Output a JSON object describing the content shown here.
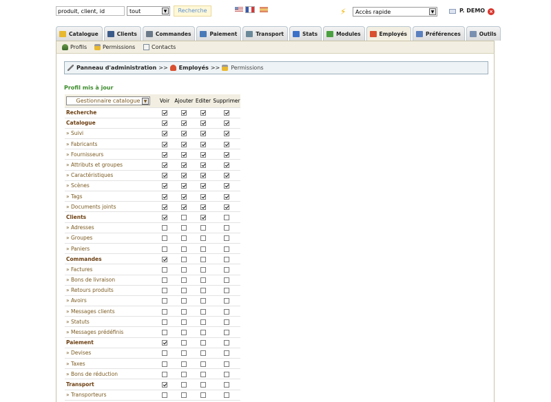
{
  "topbar": {
    "search_value": "produit, client, id",
    "search_type": "tout",
    "search_button": "Recherche",
    "quick_access": "Accès rapide",
    "user_name": "P. DEMO"
  },
  "tabs": [
    {
      "label": "Catalogue",
      "icon": "folder-icon",
      "color": "#e8b830"
    },
    {
      "label": "Clients",
      "icon": "person-icon",
      "color": "#3a5a8a"
    },
    {
      "label": "Commandes",
      "icon": "cart-icon",
      "color": "#6a7a8a"
    },
    {
      "label": "Paiement",
      "icon": "payment-icon",
      "color": "#4a7ab8"
    },
    {
      "label": "Transport",
      "icon": "truck-icon",
      "color": "#6a8a9a"
    },
    {
      "label": "Stats",
      "icon": "chart-icon",
      "color": "#3a70c8"
    },
    {
      "label": "Modules",
      "icon": "puzzle-icon",
      "color": "#4aa040"
    },
    {
      "label": "Employés",
      "icon": "employee-icon",
      "color": "#d85030"
    },
    {
      "label": "Préférences",
      "icon": "preferences-icon",
      "color": "#5a80c0"
    },
    {
      "label": "Outils",
      "icon": "tools-icon",
      "color": "#7a90b0"
    }
  ],
  "subnav": {
    "profils": "Profils",
    "permissions": "Permissions",
    "contacts": "Contacts"
  },
  "breadcrumb": {
    "root": "Panneau d'administration",
    "sep": ">>",
    "section": "Employés",
    "current": "Permissions"
  },
  "status_message": "Profil mis à jour",
  "permissions": {
    "profile": "Gestionnaire catalogue",
    "headers": [
      "Voir",
      "Ajouter",
      "Editer",
      "Supprimer"
    ],
    "rows": [
      {
        "name": "Recherche",
        "section": true,
        "checks": [
          true,
          true,
          true,
          true
        ]
      },
      {
        "name": "Catalogue",
        "section": true,
        "checks": [
          true,
          true,
          true,
          true
        ]
      },
      {
        "name": "» Suivi",
        "section": false,
        "checks": [
          true,
          true,
          true,
          true
        ]
      },
      {
        "name": "» Fabricants",
        "section": false,
        "checks": [
          true,
          true,
          true,
          true
        ]
      },
      {
        "name": "» Fournisseurs",
        "section": false,
        "checks": [
          true,
          true,
          true,
          true
        ]
      },
      {
        "name": "» Attributs et groupes",
        "section": false,
        "checks": [
          true,
          true,
          true,
          true
        ]
      },
      {
        "name": "» Caractéristiques",
        "section": false,
        "checks": [
          true,
          true,
          true,
          true
        ]
      },
      {
        "name": "» Scènes",
        "section": false,
        "checks": [
          true,
          true,
          true,
          true
        ]
      },
      {
        "name": "» Tags",
        "section": false,
        "checks": [
          true,
          true,
          true,
          true
        ]
      },
      {
        "name": "» Documents joints",
        "section": false,
        "checks": [
          true,
          true,
          true,
          true
        ]
      },
      {
        "name": "Clients",
        "section": true,
        "checks": [
          true,
          false,
          true,
          false
        ]
      },
      {
        "name": "» Adresses",
        "section": false,
        "checks": [
          false,
          false,
          false,
          false
        ]
      },
      {
        "name": "» Groupes",
        "section": false,
        "checks": [
          false,
          false,
          false,
          false
        ]
      },
      {
        "name": "» Paniers",
        "section": false,
        "checks": [
          false,
          false,
          false,
          false
        ]
      },
      {
        "name": "Commandes",
        "section": true,
        "checks": [
          true,
          false,
          false,
          false
        ]
      },
      {
        "name": "» Factures",
        "section": false,
        "checks": [
          false,
          false,
          false,
          false
        ]
      },
      {
        "name": "» Bons de livraison",
        "section": false,
        "checks": [
          false,
          false,
          false,
          false
        ]
      },
      {
        "name": "» Retours produits",
        "section": false,
        "checks": [
          false,
          false,
          false,
          false
        ]
      },
      {
        "name": "» Avoirs",
        "section": false,
        "checks": [
          false,
          false,
          false,
          false
        ]
      },
      {
        "name": "» Messages clients",
        "section": false,
        "checks": [
          false,
          false,
          false,
          false
        ]
      },
      {
        "name": "» Statuts",
        "section": false,
        "checks": [
          false,
          false,
          false,
          false
        ]
      },
      {
        "name": "» Messages prédéfinis",
        "section": false,
        "checks": [
          false,
          false,
          false,
          false
        ]
      },
      {
        "name": "Paiement",
        "section": true,
        "checks": [
          true,
          false,
          false,
          false
        ]
      },
      {
        "name": "» Devises",
        "section": false,
        "checks": [
          false,
          false,
          false,
          false
        ]
      },
      {
        "name": "» Taxes",
        "section": false,
        "checks": [
          false,
          false,
          false,
          false
        ]
      },
      {
        "name": "» Bons de réduction",
        "section": false,
        "checks": [
          false,
          false,
          false,
          false
        ]
      },
      {
        "name": "Transport",
        "section": true,
        "checks": [
          true,
          false,
          false,
          false
        ]
      },
      {
        "name": "» Transporteurs",
        "section": false,
        "checks": [
          false,
          false,
          false,
          false
        ]
      }
    ]
  }
}
